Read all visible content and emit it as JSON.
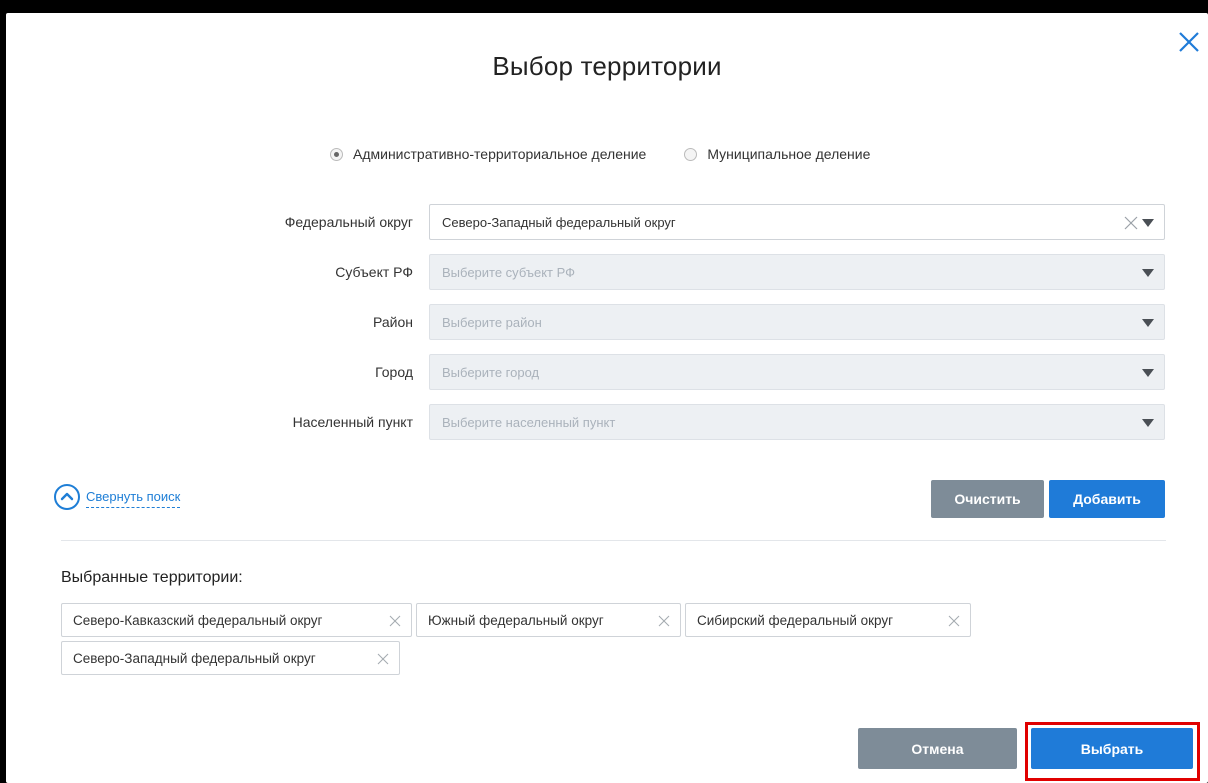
{
  "dialog": {
    "title": "Выбор территории"
  },
  "division": {
    "options": [
      {
        "label": "Административно-территориальное деление",
        "checked": true
      },
      {
        "label": "Муниципальное деление",
        "checked": false
      }
    ]
  },
  "form": {
    "fields": [
      {
        "label": "Федеральный округ",
        "value": "Северо-Западный федеральный округ",
        "placeholder": "",
        "disabled": false,
        "clearable": true
      },
      {
        "label": "Субъект РФ",
        "value": "",
        "placeholder": "Выберите субъект РФ",
        "disabled": true,
        "clearable": false
      },
      {
        "label": "Район",
        "value": "",
        "placeholder": "Выберите район",
        "disabled": true,
        "clearable": false
      },
      {
        "label": "Город",
        "value": "",
        "placeholder": "Выберите город",
        "disabled": true,
        "clearable": false
      },
      {
        "label": "Населенный пункт",
        "value": "",
        "placeholder": "Выберите населенный пункт",
        "disabled": true,
        "clearable": false
      }
    ]
  },
  "search": {
    "collapse_label": "Свернуть поиск",
    "clear_label": "Очистить",
    "add_label": "Добавить"
  },
  "selected": {
    "title": "Выбранные территории:",
    "items": [
      "Северо-Кавказский федеральный округ",
      "Южный федеральный округ",
      "Сибирский федеральный округ",
      "Северо-Западный федеральный округ"
    ]
  },
  "footer": {
    "cancel_label": "Отмена",
    "select_label": "Выбрать"
  },
  "colors": {
    "accent": "#1f7bd8",
    "secondary_button": "#7e8c98",
    "highlight": "#e00000"
  }
}
